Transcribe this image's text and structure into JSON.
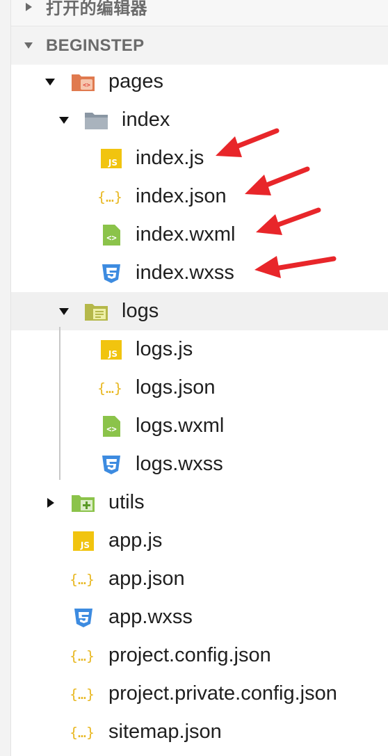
{
  "explorer": {
    "open_editors_label": "打开的编辑器",
    "workspace_label": "BEGINSTEP"
  },
  "tree": {
    "pages": {
      "label": "pages",
      "icon": "pages-folder-icon"
    },
    "index": {
      "label": "index",
      "icon": "folder-icon"
    },
    "index_js": {
      "label": "index.js",
      "icon": "js-file-icon"
    },
    "index_json": {
      "label": "index.json",
      "icon": "json-file-icon"
    },
    "index_wxml": {
      "label": "index.wxml",
      "icon": "wxml-file-icon"
    },
    "index_wxss": {
      "label": "index.wxss",
      "icon": "css-file-icon"
    },
    "logs": {
      "label": "logs",
      "icon": "logs-folder-icon"
    },
    "logs_js": {
      "label": "logs.js",
      "icon": "js-file-icon"
    },
    "logs_json": {
      "label": "logs.json",
      "icon": "json-file-icon"
    },
    "logs_wxml": {
      "label": "logs.wxml",
      "icon": "wxml-file-icon"
    },
    "logs_wxss": {
      "label": "logs.wxss",
      "icon": "css-file-icon"
    },
    "utils": {
      "label": "utils",
      "icon": "utils-folder-icon"
    },
    "app_js": {
      "label": "app.js",
      "icon": "js-file-icon"
    },
    "app_json": {
      "label": "app.json",
      "icon": "json-file-icon"
    },
    "app_wxss": {
      "label": "app.wxss",
      "icon": "css-file-icon"
    },
    "project_config": {
      "label": "project.config.json",
      "icon": "json-file-icon"
    },
    "project_private_config": {
      "label": "project.private.config.json",
      "icon": "json-file-icon"
    },
    "sitemap": {
      "label": "sitemap.json",
      "icon": "json-file-icon"
    }
  },
  "colors": {
    "js": "#f1c40f",
    "json": "#e8b720",
    "wxml": "#8bc34a",
    "css": "#3d8be0",
    "pages_folder": "#e07a4f",
    "index_folder": "#8a96a3",
    "logs_folder": "#b5b84a",
    "utils_folder": "#8bc34a",
    "annotation_arrow": "#e8262a"
  }
}
